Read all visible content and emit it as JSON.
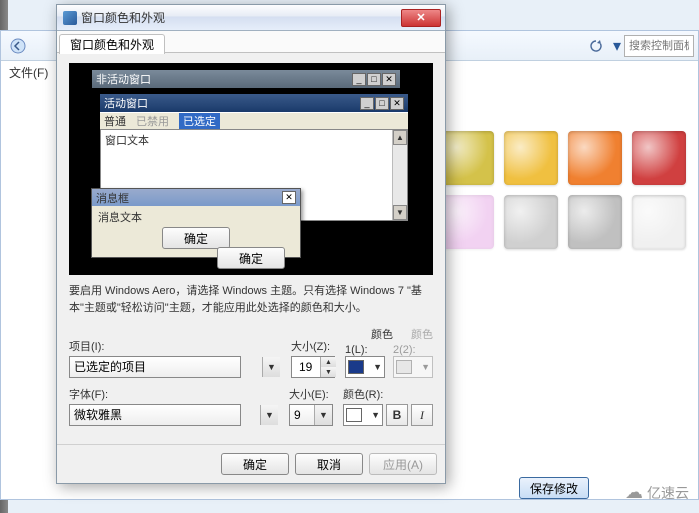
{
  "bg": {
    "search_placeholder": "搜索控制面板",
    "menu_file": "文件(F)",
    "save_btn": "保存修改",
    "logo_text": "亿速云"
  },
  "dialog": {
    "title": "窗口颜色和外观",
    "tab": "窗口颜色和外观",
    "close_glyph": "✕",
    "preview": {
      "inactive_title": "非活动窗口",
      "active_title": "活动窗口",
      "menu_normal": "普通",
      "menu_disabled": "已禁用",
      "menu_selected": "已选定",
      "window_text": "窗口文本",
      "msgbox_title": "消息框",
      "msgbox_text": "消息文本",
      "msgbox_close": "✕",
      "ok_btn": "确定"
    },
    "info": "要启用 Windows Aero，请选择 Windows 主题。只有选择 Windows 7 \"基本\"主题或\"轻松访问\"主题，才能应用此处选择的颜色和大小。",
    "item_label": "项目(I):",
    "item_value": "已选定的项目",
    "size_label": "大小(Z):",
    "size_value": "19",
    "color_header": "颜色",
    "color1_label": "1(L):",
    "color2_label": "2(2):",
    "color1_value": "#1a3a8a",
    "font_label": "字体(F):",
    "font_value": "微软雅黑",
    "fsize_label": "大小(E):",
    "fsize_value": "9",
    "fcolor_label": "颜色(R):",
    "fcolor_value": "#ffffff",
    "bold_glyph": "B",
    "italic_glyph": "I",
    "ok": "确定",
    "cancel": "取消",
    "apply": "应用(A)"
  }
}
